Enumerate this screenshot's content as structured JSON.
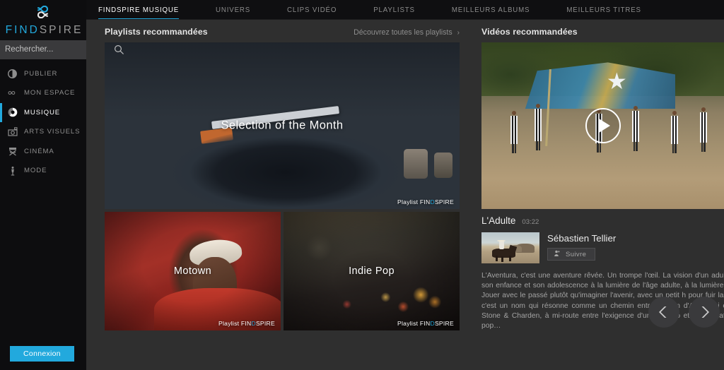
{
  "brand": {
    "logo_prefix": "FIND",
    "logo_suffix": "SPIRE",
    "accent_color": "#22a9dd",
    "logo_icon": "infinity-icon"
  },
  "sidebar": {
    "search": {
      "placeholder": "Rechercher...",
      "value": "",
      "icon": "search-icon"
    },
    "items": [
      {
        "label": "PUBLIER",
        "icon": "publish-icon",
        "active": false
      },
      {
        "label": "MON ESPACE",
        "icon": "infinity-icon",
        "active": false
      },
      {
        "label": "MUSIQUE",
        "icon": "vinyl-icon",
        "active": true
      },
      {
        "label": "ARTS VISUELS",
        "icon": "camera-icon",
        "active": false
      },
      {
        "label": "CINÉMA",
        "icon": "director-chair-icon",
        "active": false
      },
      {
        "label": "MODE",
        "icon": "mannequin-icon",
        "active": false
      }
    ],
    "login_button": "Connexion"
  },
  "topnav": {
    "tabs": [
      {
        "label": "FINDSPIRE MUSIQUE",
        "active": true
      },
      {
        "label": "UNIVERS",
        "active": false
      },
      {
        "label": "CLIPS VIDÉO",
        "active": false
      },
      {
        "label": "PLAYLISTS",
        "active": false
      },
      {
        "label": "MEILLEURS ALBUMS",
        "active": false
      },
      {
        "label": "MEILLEURS TITRES",
        "active": false
      }
    ]
  },
  "playlists_section": {
    "title": "Playlists recommandées",
    "discover_link": "Découvrez toutes les playlists",
    "discover_chevron": "chevron-right-icon",
    "badge_prefix": "Playlist ",
    "badge_part1": "FIN",
    "badge_part2": "D",
    "badge_part3": "SPIRE",
    "tiles": [
      {
        "caption": "Selection of the Month",
        "size": "large"
      },
      {
        "caption": "Motown",
        "size": "small"
      },
      {
        "caption": "Indie Pop",
        "size": "small"
      }
    ]
  },
  "videos_section": {
    "title": "Vidéos recommandées",
    "play_icon": "play-icon",
    "video": {
      "title": "L'Adulte",
      "duration": "03:22",
      "artist": "Sébastien Tellier",
      "follow_label": "Suivre",
      "follow_icon": "add-person-icon",
      "description": "L'Aventura, c'est une aventure rêvée. Un trompe l'œil. La vision d'un adulescent, qui revisite son enfance et son adolescence à la lumière de l'âge adulte, à la lumière du soleil du Brésil. Jouer avec le passé plutôt qu'imaginer l'avenir, avec un petit h pour fuir la réalité. L'Aventura, c'est un nom qui résonne comme un chemin entre un film d'Antonioni et une chanson de Stone & Charden, à mi-route entre l'exigence d'un maestro et l'immédiateté d'une chanson pop…"
    },
    "prev_icon": "chevron-left-icon",
    "next_icon": "chevron-right-icon"
  }
}
